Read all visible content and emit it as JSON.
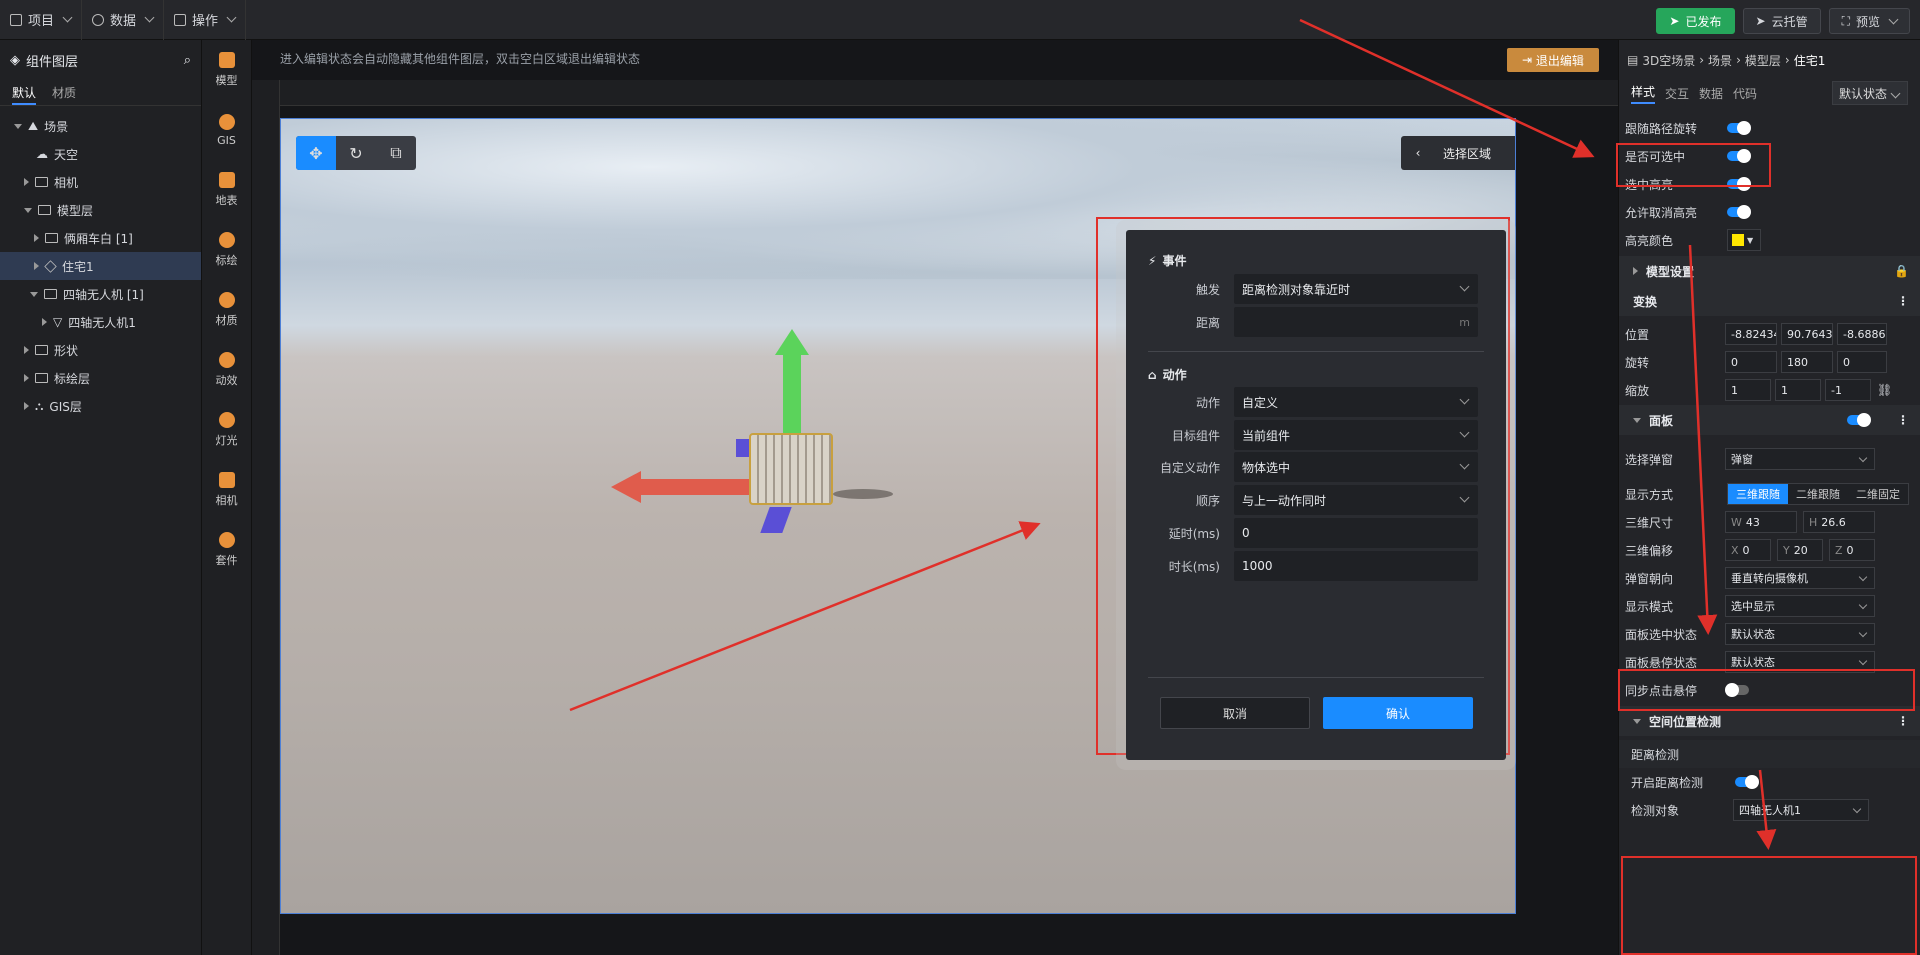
{
  "topbar": {
    "menu_project": "项目",
    "menu_data": "数据",
    "menu_ops": "操作",
    "published": "已发布",
    "cloud": "云托管",
    "preview": "预览"
  },
  "layers": {
    "title": "组件图层",
    "tab_default": "默认",
    "tab_material": "材质",
    "tree": [
      "场景",
      "天空",
      "相机",
      "模型层",
      "俩厢车白 [1]",
      "住宅1",
      "四轴无人机 [1]",
      "四轴无人机1",
      "形状",
      "标绘层",
      "GIS层"
    ]
  },
  "iconbar": [
    "模型",
    "GIS",
    "地表",
    "标绘",
    "材质",
    "动效",
    "灯光",
    "相机",
    "套件"
  ],
  "canvas": {
    "hint": "进入编辑状态会自动隐藏其他组件图层，双击空白区域退出编辑状态",
    "exit": "退出编辑",
    "select_area": "选择区域"
  },
  "modal": {
    "event_title": "事件",
    "trigger_label": "触发",
    "trigger_value": "距离检测对象靠近时",
    "distance_label": "距离",
    "distance_unit": "m",
    "action_title": "动作",
    "action_label": "动作",
    "action_value": "自定义",
    "target_label": "目标组件",
    "target_value": "当前组件",
    "custom_label": "自定义动作",
    "custom_value": "物体选中",
    "order_label": "顺序",
    "order_value": "与上一动作同时",
    "delay_label": "延时(ms)",
    "delay_value": "0",
    "duration_label": "时长(ms)",
    "duration_value": "1000",
    "cancel": "取消",
    "confirm": "确认"
  },
  "props": {
    "breadcrumb": [
      "3D空场景",
      "场景",
      "模型层",
      "住宅1"
    ],
    "tabs": [
      "样式",
      "交互",
      "数据",
      "代码"
    ],
    "state": "默认状态",
    "follow_rotate": "跟随路径旋转",
    "selectable": "是否可选中",
    "sel_highlight": "选中高亮",
    "allow_cancel": "允许取消高亮",
    "hl_color": "高亮颜色",
    "model_settings": "模型设置",
    "transform": "变换",
    "pos": "位置",
    "pos_vals": [
      "-8.824344",
      "90.764343",
      "-8.688633"
    ],
    "rot": "旋转",
    "rot_vals": [
      "0",
      "180",
      "0"
    ],
    "scale": "缩放",
    "scale_vals": [
      "1",
      "1",
      "-1"
    ],
    "panel": "面板",
    "popup_sel": "选择弹窗",
    "popup_val": "弹窗",
    "display": "显示方式",
    "display_opts": [
      "三维跟随",
      "二维跟随",
      "二维固定"
    ],
    "size3d": "三维尺寸",
    "w": "43",
    "h": "26.6",
    "offset3d": "三维偏移",
    "x": "0",
    "y": "20",
    "z": "0",
    "orient": "弹窗朝向",
    "orient_val": "垂直转向摄像机",
    "mode": "显示模式",
    "mode_val": "选中显示",
    "sel_state": "面板选中状态",
    "sel_state_val": "默认状态",
    "hover_state": "面板悬停状态",
    "hover_state_val": "默认状态",
    "sync_hover": "同步点击悬停",
    "spatial": "空间位置检测",
    "dist_detect": "距离检测",
    "enable_dist": "开启距离检测",
    "detect_obj": "检测对象",
    "detect_obj_val": "四轴无人机1"
  },
  "colors": {
    "accent": "#1a8cff",
    "publish": "#26a65b",
    "highlight": "#ffe600",
    "annotation": "#e0302a"
  }
}
